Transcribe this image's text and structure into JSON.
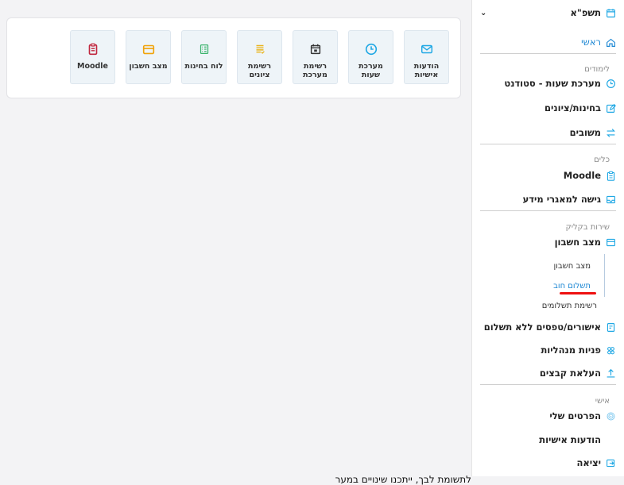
{
  "year": {
    "label": "תשפ\"א"
  },
  "sidebar": {
    "home": "ראשי",
    "sections": {
      "studies": "לימודים",
      "tools": "כלים",
      "click_service": "שירות בקליק",
      "personal": "אישי"
    },
    "studies": {
      "timetable": "מערכת שעות - סטודנט",
      "exams": "בחינות/ציונים",
      "feedback": "משובים"
    },
    "tools": {
      "moodle": "Moodle",
      "databases": "גישה למאגרי מידע"
    },
    "click": {
      "account": "מצב חשבון",
      "sub": [
        "מצב חשבון",
        "תשלום חוב",
        "רשימת תשלומים"
      ],
      "approvals": "אישורים/טפסים ללא תשלום",
      "admin_requests": "פניות מנהליות",
      "upload": "העלאת קבצים"
    },
    "personal": {
      "details": "הפרטים שלי",
      "messages": "הודעות אישיות",
      "logout": "יציאה"
    }
  },
  "tiles": [
    {
      "label": "הודעות אישיות",
      "icon": "mail-icon",
      "color": "#1ea7e4"
    },
    {
      "label": "מערכת שעות",
      "icon": "clock-icon",
      "color": "#1ea7e4"
    },
    {
      "label": "רשימת מערכת",
      "icon": "calendar-icon",
      "color": "#333333"
    },
    {
      "label": "רשימת ציונים",
      "icon": "list-icon",
      "color": "#e9b41c"
    },
    {
      "label": "לוח בחינות",
      "icon": "table-icon",
      "color": "#3bb36c"
    },
    {
      "label": "מצב חשבון",
      "icon": "wallet-icon",
      "color": "#f0a30a"
    },
    {
      "label": "Moodle",
      "icon": "clipboard-icon",
      "color": "#c0263e"
    }
  ],
  "note": "לתשומת לבך, ייתכנו שינויים במער"
}
